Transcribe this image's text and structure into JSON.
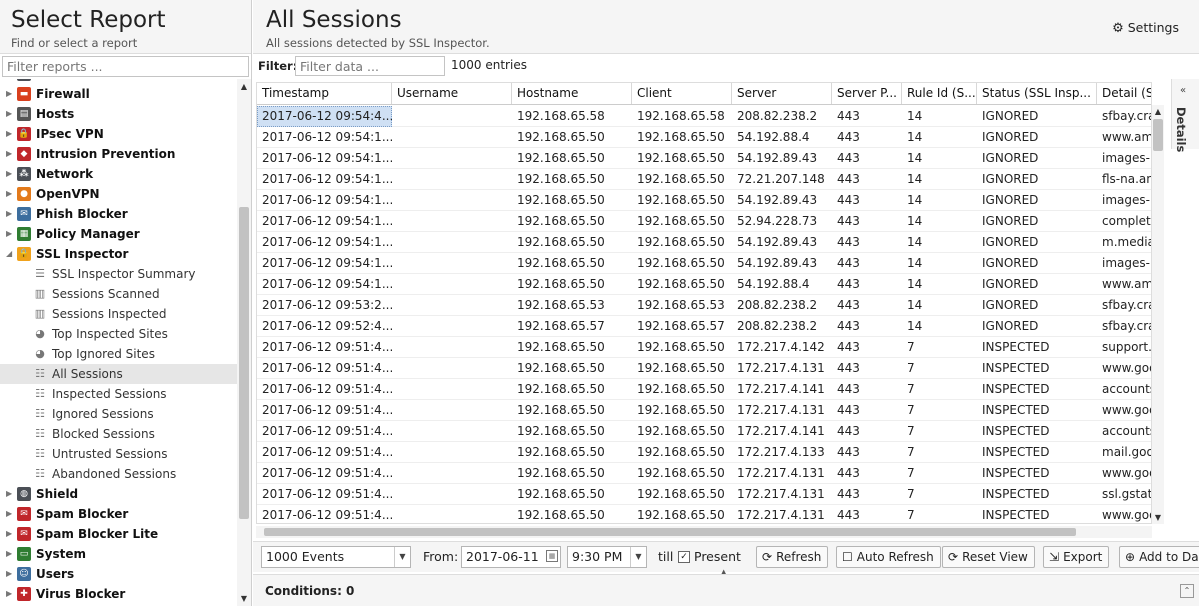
{
  "left": {
    "title": "Select Report",
    "subtitle": "Find or select a report",
    "filter_placeholder": "Filter reports ...",
    "tree": [
      {
        "label": "Firewall",
        "icon": "firewall-icon",
        "color": "#d9401e",
        "glyph": "▬"
      },
      {
        "label": "Hosts",
        "icon": "hosts-icon",
        "color": "#555555",
        "glyph": "▤"
      },
      {
        "label": "IPsec VPN",
        "icon": "lock-icon",
        "color": "#c0262a",
        "glyph": "🔒"
      },
      {
        "label": "Intrusion Prevention",
        "icon": "intrusion-icon",
        "color": "#c0262a",
        "glyph": "◆"
      },
      {
        "label": "Network",
        "icon": "network-icon",
        "color": "#4b4f56",
        "glyph": "⁂"
      },
      {
        "label": "OpenVPN",
        "icon": "openvpn-icon",
        "color": "#e37a1b",
        "glyph": "●"
      },
      {
        "label": "Phish Blocker",
        "icon": "phish-icon",
        "color": "#3d6e9e",
        "glyph": "✉"
      },
      {
        "label": "Policy Manager",
        "icon": "policy-icon",
        "color": "#2f7d32",
        "glyph": "▦"
      }
    ],
    "ssl": {
      "label": "SSL Inspector",
      "children": [
        {
          "label": "SSL Inspector Summary",
          "icon": "text-lines-icon",
          "glyph": "☰"
        },
        {
          "label": "Sessions Scanned",
          "icon": "bar-chart-icon",
          "glyph": "▥"
        },
        {
          "label": "Sessions Inspected",
          "icon": "bar-chart-icon",
          "glyph": "▥"
        },
        {
          "label": "Top Inspected Sites",
          "icon": "pie-chart-icon",
          "glyph": "◕"
        },
        {
          "label": "Top Ignored Sites",
          "icon": "pie-chart-icon",
          "glyph": "◕"
        },
        {
          "label": "All Sessions",
          "icon": "list-icon",
          "glyph": "☷"
        },
        {
          "label": "Inspected Sessions",
          "icon": "list-icon",
          "glyph": "☷"
        },
        {
          "label": "Ignored Sessions",
          "icon": "list-icon",
          "glyph": "☷"
        },
        {
          "label": "Blocked Sessions",
          "icon": "list-icon",
          "glyph": "☷"
        },
        {
          "label": "Untrusted Sessions",
          "icon": "list-icon",
          "glyph": "☷"
        },
        {
          "label": "Abandoned Sessions",
          "icon": "list-icon",
          "glyph": "☷"
        }
      ]
    },
    "tree_after": [
      {
        "label": "Shield",
        "icon": "shield-icon",
        "color": "#4b4f56",
        "glyph": "◍"
      },
      {
        "label": "Spam Blocker",
        "icon": "spam-icon",
        "color": "#c0262a",
        "glyph": "✉"
      },
      {
        "label": "Spam Blocker Lite",
        "icon": "spam-lite-icon",
        "color": "#c0262a",
        "glyph": "✉"
      },
      {
        "label": "System",
        "icon": "system-icon",
        "color": "#2f7d32",
        "glyph": "▭"
      },
      {
        "label": "Users",
        "icon": "users-icon",
        "color": "#3d6e9e",
        "glyph": "☺"
      },
      {
        "label": "Virus Blocker",
        "icon": "virus-icon",
        "color": "#c0262a",
        "glyph": "✚"
      }
    ]
  },
  "main": {
    "title": "All Sessions",
    "subtitle": "All sessions detected by SSL Inspector.",
    "settings_label": "Settings",
    "filter_label": "Filter:",
    "filter_placeholder": "Filter data ...",
    "entries": "1000 entries",
    "details_label": "Details"
  },
  "table": {
    "columns": [
      "Timestamp",
      "Username",
      "Hostname",
      "Client",
      "Server",
      "Server P...",
      "Rule Id (S...",
      "Status (SSL Insp...",
      "Detail (SSL"
    ],
    "rows": [
      [
        "2017-06-12 09:54:4...",
        "",
        "192.168.65.58",
        "192.168.65.58",
        "208.82.238.2",
        "443",
        "14",
        "IGNORED",
        "sfbay.cra"
      ],
      [
        "2017-06-12 09:54:1...",
        "",
        "192.168.65.50",
        "192.168.65.50",
        "54.192.88.4",
        "443",
        "14",
        "IGNORED",
        "www.am"
      ],
      [
        "2017-06-12 09:54:1...",
        "",
        "192.168.65.50",
        "192.168.65.50",
        "54.192.89.43",
        "443",
        "14",
        "IGNORED",
        "images-n"
      ],
      [
        "2017-06-12 09:54:1...",
        "",
        "192.168.65.50",
        "192.168.65.50",
        "72.21.207.148",
        "443",
        "14",
        "IGNORED",
        "fls-na.an"
      ],
      [
        "2017-06-12 09:54:1...",
        "",
        "192.168.65.50",
        "192.168.65.50",
        "54.192.89.43",
        "443",
        "14",
        "IGNORED",
        "images-n"
      ],
      [
        "2017-06-12 09:54:1...",
        "",
        "192.168.65.50",
        "192.168.65.50",
        "52.94.228.73",
        "443",
        "14",
        "IGNORED",
        "completi"
      ],
      [
        "2017-06-12 09:54:1...",
        "",
        "192.168.65.50",
        "192.168.65.50",
        "54.192.89.43",
        "443",
        "14",
        "IGNORED",
        "m.media"
      ],
      [
        "2017-06-12 09:54:1...",
        "",
        "192.168.65.50",
        "192.168.65.50",
        "54.192.89.43",
        "443",
        "14",
        "IGNORED",
        "images-n"
      ],
      [
        "2017-06-12 09:54:1...",
        "",
        "192.168.65.50",
        "192.168.65.50",
        "54.192.88.4",
        "443",
        "14",
        "IGNORED",
        "www.am"
      ],
      [
        "2017-06-12 09:53:2...",
        "",
        "192.168.65.53",
        "192.168.65.53",
        "208.82.238.2",
        "443",
        "14",
        "IGNORED",
        "sfbay.cra"
      ],
      [
        "2017-06-12 09:52:4...",
        "",
        "192.168.65.57",
        "192.168.65.57",
        "208.82.238.2",
        "443",
        "14",
        "IGNORED",
        "sfbay.cra"
      ],
      [
        "2017-06-12 09:51:4...",
        "",
        "192.168.65.50",
        "192.168.65.50",
        "172.217.4.142",
        "443",
        "7",
        "INSPECTED",
        "support."
      ],
      [
        "2017-06-12 09:51:4...",
        "",
        "192.168.65.50",
        "192.168.65.50",
        "172.217.4.131",
        "443",
        "7",
        "INSPECTED",
        "www.goo"
      ],
      [
        "2017-06-12 09:51:4...",
        "",
        "192.168.65.50",
        "192.168.65.50",
        "172.217.4.141",
        "443",
        "7",
        "INSPECTED",
        "accounts"
      ],
      [
        "2017-06-12 09:51:4...",
        "",
        "192.168.65.50",
        "192.168.65.50",
        "172.217.4.131",
        "443",
        "7",
        "INSPECTED",
        "www.goo"
      ],
      [
        "2017-06-12 09:51:4...",
        "",
        "192.168.65.50",
        "192.168.65.50",
        "172.217.4.141",
        "443",
        "7",
        "INSPECTED",
        "accounts"
      ],
      [
        "2017-06-12 09:51:4...",
        "",
        "192.168.65.50",
        "192.168.65.50",
        "172.217.4.133",
        "443",
        "7",
        "INSPECTED",
        "mail.goo"
      ],
      [
        "2017-06-12 09:51:4...",
        "",
        "192.168.65.50",
        "192.168.65.50",
        "172.217.4.131",
        "443",
        "7",
        "INSPECTED",
        "www.goo"
      ],
      [
        "2017-06-12 09:51:4...",
        "",
        "192.168.65.50",
        "192.168.65.50",
        "172.217.4.131",
        "443",
        "7",
        "INSPECTED",
        "ssl.gstat"
      ],
      [
        "2017-06-12 09:51:4...",
        "",
        "192.168.65.50",
        "192.168.65.50",
        "172.217.4.131",
        "443",
        "7",
        "INSPECTED",
        "www.goo"
      ]
    ]
  },
  "toolbar": {
    "events": "1000 Events",
    "from_label": "From:",
    "from_date": "2017-06-11",
    "from_time": "9:30 PM",
    "till_label": "till",
    "present_label": "Present",
    "present_checked": "✓",
    "refresh": "Refresh",
    "auto_refresh": "Auto Refresh",
    "reset_view": "Reset View",
    "export": "Export",
    "add_to": "Add to Da"
  },
  "conditions": "Conditions: 0"
}
